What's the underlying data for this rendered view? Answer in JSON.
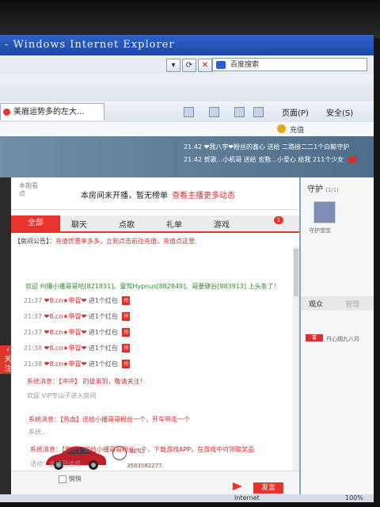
{
  "window": {
    "title": "- Windows Internet Explorer"
  },
  "address_bar": {
    "search_placeholder": "百度搜索"
  },
  "browser_tab": {
    "label": "美眉运势多的左大..."
  },
  "command_bar": {
    "page_menu": "页面(P)",
    "safety_menu": "安全(S)"
  },
  "site_header": {
    "recharge": "充值"
  },
  "ticker": [
    {
      "time": "21:42",
      "text": "❤我八字❤粉丝的鑫心 送给 二路接二二1个白鲸守护"
    },
    {
      "time": "21:42",
      "text": "贺歌...小机哥 送给 宏数...小爱心 给我 211个少女"
    }
  ],
  "announcement": {
    "label": "本期看点",
    "text": "本房间未开播，暂无榜单",
    "link": "查看主播更多动态"
  },
  "chat_tabs": [
    {
      "label": "全部",
      "active": true
    },
    {
      "label": "聊天",
      "active": false
    },
    {
      "label": "点歌",
      "active": false
    },
    {
      "label": "礼单",
      "active": false
    },
    {
      "label": "游戏",
      "active": false
    }
  ],
  "chat_badge": "1",
  "notice": {
    "prefix": "【房间公告】：",
    "text": "充值优惠享多多，立刻点击前往充值，充值点这里"
  },
  "welcome": {
    "text": "欢迎 州爆小播哥哥哈[821831]、童驾Hypnus[882849]、哥要健谷[883913] 上头条了！"
  },
  "messages": [
    {
      "time": "21:37",
      "user": "❤8.cn★带冒❤",
      "action": "进1个红包",
      "tag": "抢"
    },
    {
      "time": "21:37",
      "user": "❤8.cn★带冒❤",
      "action": "进1个红包",
      "tag": "抢"
    },
    {
      "time": "21:37",
      "user": "❤8.cn★带冒❤",
      "action": "进1个红包",
      "tag": "抢"
    },
    {
      "time": "21:38",
      "user": "❤8.cn★带冒❤",
      "action": "进1个红包",
      "tag": "抢"
    },
    {
      "time": "21:38",
      "user": "❤8.cn★带冒❤",
      "action": "进1个红包",
      "tag": "抢"
    }
  ],
  "system_lines": [
    "系统消息：【冲冲】 的徒弟到，敬请关注！",
    "欢迎 VIP专山子进入房间"
  ],
  "car_info": {
    "brand": "BENZ",
    "code": "3583582277"
  },
  "system_lines_2": [
    "系统消息：【热血】送给小播哥哥粉丝一个，开车带走一个",
    "系统...",
    "系统消息：【热血】送给小播哥哥粉丝一个，下载游戏APP，在游戏中可领取奖品",
    "活动：主播已达成..."
  ],
  "chat_input": {
    "checkbox_label": "悄悄",
    "send": "发言"
  },
  "right_panel": {
    "guard_title": "守护",
    "guard_count": "(1/1)",
    "guard_name": "守护宝宝",
    "tabs": [
      "观众",
      "管理"
    ],
    "viewer_level": "富",
    "viewer_name": "丹心烟九八月"
  },
  "status_bar": {
    "zone": "Internet",
    "zoom": "100%"
  }
}
